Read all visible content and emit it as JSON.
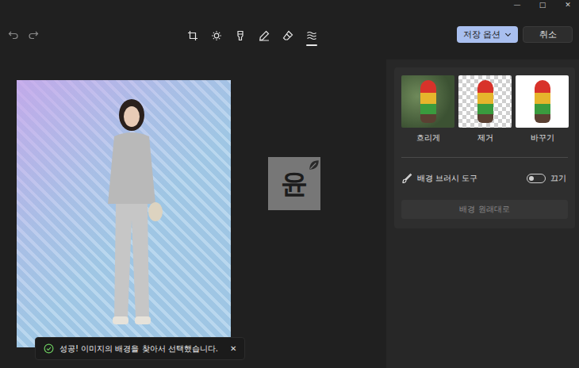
{
  "window": {
    "controls": [
      "—",
      "□",
      "✕"
    ]
  },
  "toolbar": {
    "tools": [
      {
        "kind": "crop",
        "selected": false
      },
      {
        "kind": "adjust",
        "selected": false
      },
      {
        "kind": "filter",
        "selected": false
      },
      {
        "kind": "markup",
        "selected": false
      },
      {
        "kind": "erase",
        "selected": false
      },
      {
        "kind": "background",
        "selected": true
      }
    ],
    "save_button": "저장 옵션",
    "cancel_button": "취소"
  },
  "watermark": "윤",
  "toast": {
    "message": "성공! 이미지의 배경을 찾아서 선택했습니다.",
    "close": "✕"
  },
  "panel": {
    "options": [
      {
        "kind": "blur",
        "label": "흐리게"
      },
      {
        "kind": "remove",
        "label": "제거"
      },
      {
        "kind": "replace",
        "label": "바꾸기"
      }
    ],
    "brush": {
      "label": "배경 브러시 도구",
      "on": false,
      "state_label": "끄기"
    },
    "reset": {
      "label": "배경 원래대로",
      "disabled": true
    }
  }
}
